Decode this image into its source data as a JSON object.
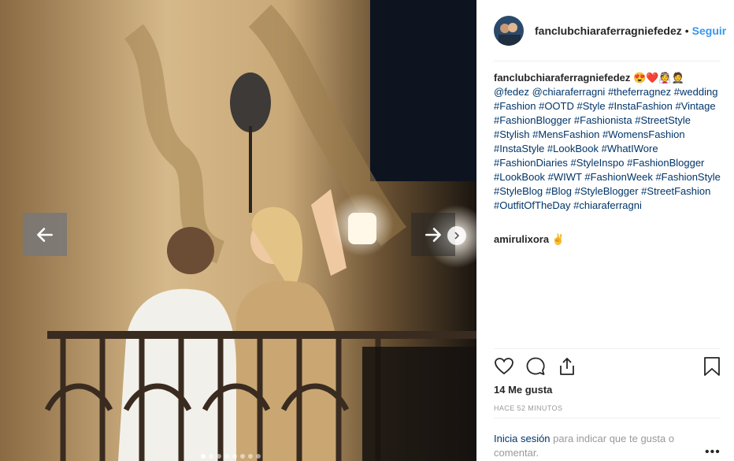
{
  "post": {
    "username": "fanclubchiaraferragniefedez",
    "separator": "•",
    "follow_label": "Seguir",
    "caption_emoji": "😍❤️👰🤵",
    "caption_mention_1": "@fedez",
    "caption_mention_2": "@chiaraferragni",
    "hashtags": "#theferragnez #wedding #Fashion #OOTD #Style #InstaFashion #Vintage #FashionBlogger #Fashionista #StreetStyle #Stylish #MensFashion #WomensFashion #InstaStyle #LookBook #WhatIWore #FashionDiaries #StyleInspo #FashionBlogger #LookBook #WIWT #FashionWeek #FashionStyle #StyleBlog #Blog #StyleBlogger #StreetFashion #OutfitOfTheDay #chiaraferragni",
    "comment_user": "amirulixora",
    "comment_text": "✌",
    "likes": "14 Me gusta",
    "time": "HACE 52 MINUTOS",
    "login_link": "Inicia sesión",
    "login_text": " para indicar que te gusta o comentar.",
    "more": "•••"
  },
  "carousel": {
    "slide_count": 8,
    "active_index": 0
  },
  "icons": {
    "prev": "arrow-left-icon",
    "next": "arrow-right-icon",
    "chevron": "chevron-right-icon",
    "like": "heart-icon",
    "comment": "comment-icon",
    "share": "share-icon",
    "save": "bookmark-icon"
  },
  "colors": {
    "link": "#3897f0",
    "hashtag": "#003569",
    "muted": "#999999"
  }
}
